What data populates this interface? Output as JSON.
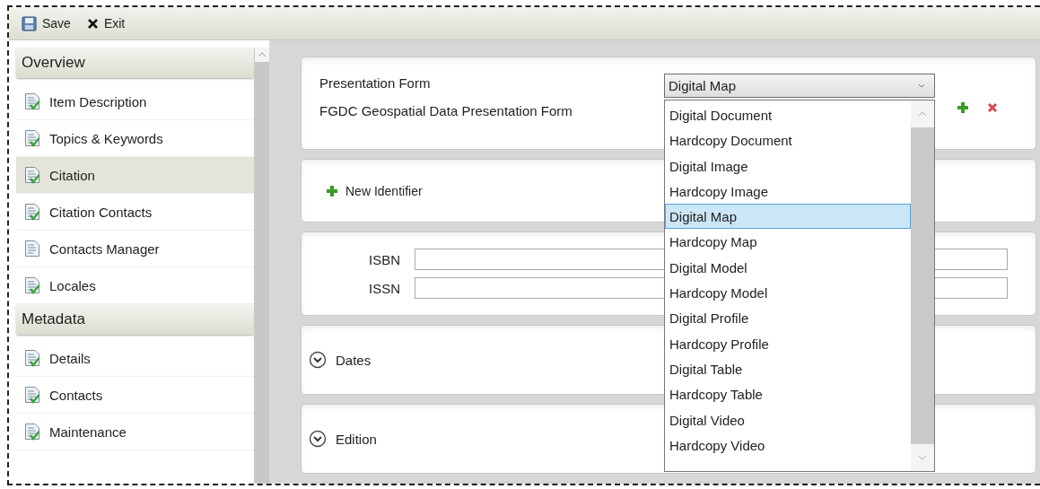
{
  "toolbar": [
    {
      "kind": "save",
      "label": "Save"
    },
    {
      "kind": "exit",
      "label": "Exit"
    }
  ],
  "sidebar": {
    "sections": [
      {
        "title": "Overview",
        "items": [
          {
            "label": "Item Description",
            "selected": false,
            "complete": true
          },
          {
            "label": "Topics & Keywords",
            "selected": false,
            "complete": true
          },
          {
            "label": "Citation",
            "selected": true,
            "complete": true
          },
          {
            "label": "Citation Contacts",
            "selected": false,
            "complete": true
          },
          {
            "label": "Contacts Manager",
            "selected": false,
            "complete": false
          },
          {
            "label": "Locales",
            "selected": false,
            "complete": true
          }
        ]
      },
      {
        "title": "Metadata",
        "items": [
          {
            "label": "Details",
            "selected": false,
            "complete": true
          },
          {
            "label": "Contacts",
            "selected": false,
            "complete": true
          },
          {
            "label": "Maintenance",
            "selected": false,
            "complete": true
          }
        ]
      }
    ]
  },
  "presentation_form": {
    "label": "Presentation Form",
    "sublabel": "FGDC Geospatial Data Presentation Form",
    "value": "Digital Map",
    "expanded": true,
    "options": [
      {
        "label": "Digital Document",
        "selected": false
      },
      {
        "label": "Hardcopy Document",
        "selected": false
      },
      {
        "label": "Digital Image",
        "selected": false
      },
      {
        "label": "Hardcopy Image",
        "selected": false
      },
      {
        "label": "Digital Map",
        "selected": true
      },
      {
        "label": "Hardcopy Map",
        "selected": false
      },
      {
        "label": "Digital Model",
        "selected": false
      },
      {
        "label": "Hardcopy Model",
        "selected": false
      },
      {
        "label": "Digital Profile",
        "selected": false
      },
      {
        "label": "Hardcopy Profile",
        "selected": false
      },
      {
        "label": "Digital Table",
        "selected": false
      },
      {
        "label": "Hardcopy Table",
        "selected": false
      },
      {
        "label": "Digital Video",
        "selected": false
      },
      {
        "label": "Hardcopy Video",
        "selected": false
      }
    ]
  },
  "new_identifier": {
    "label": "New Identifier"
  },
  "identifiers": [
    {
      "label": "ISBN"
    },
    {
      "label": "ISSN"
    }
  ],
  "sections": [
    {
      "label": "Dates",
      "expanded": false
    },
    {
      "label": "Edition",
      "expanded": false
    }
  ]
}
